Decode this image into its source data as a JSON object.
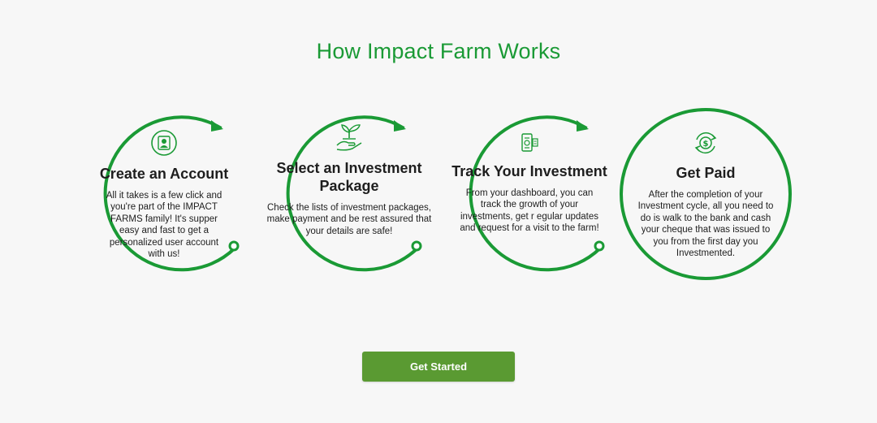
{
  "title": "How Impact Farm Works",
  "steps": [
    {
      "icon": "user-account-icon",
      "title": "Create an Account",
      "description": "All it takes is a few click and you're part of the IMPACT FARMS family! It's supper easy and fast to get a personalized user account with us!"
    },
    {
      "icon": "plant-in-hand-icon",
      "title": "Select an Investment Package",
      "description": "Check the lists of investment packages, make payment and be rest assured that your details are safe!"
    },
    {
      "icon": "dashboard-tracking-icon",
      "title": "Track Your Investment",
      "description": "From your dashboard, you can track the growth of your investments, get r egular updates and request for a visit to the farm!"
    },
    {
      "icon": "money-cycle-icon",
      "title": "Get Paid",
      "description": "After the completion of your Investment cycle, all you need to do is walk to the bank and cash your cheque that was issued to you from the first day you Investmented."
    }
  ],
  "cta": {
    "label": "Get Started"
  },
  "colors": {
    "accent": "#1a9a35",
    "button": "#5a9a32",
    "background": "#f7f7f7"
  }
}
